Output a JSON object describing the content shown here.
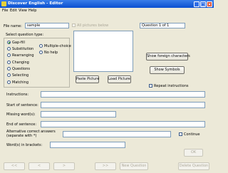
{
  "window": {
    "title": "Discover English - Editor",
    "minimize": "_",
    "maximize": "□",
    "close": "×"
  },
  "menu": [
    "File",
    "Edit",
    "View",
    "Help"
  ],
  "file": {
    "label": "File name:",
    "value": "sample",
    "all_pictures_label": "All pictures below"
  },
  "question_counter": "Question 1 of 1",
  "question_type": {
    "label": "Select question type:",
    "left": [
      {
        "label": "Gap-fill",
        "selected": true
      },
      {
        "label": "Substitution",
        "selected": false
      },
      {
        "label": "Rearranging",
        "selected": false
      },
      {
        "label": "Changing",
        "selected": false
      },
      {
        "label": "Questions",
        "selected": false
      },
      {
        "label": "Selecting",
        "selected": false
      },
      {
        "label": "Matching",
        "selected": false
      }
    ],
    "right": [
      {
        "label": "Multiple-choice",
        "selected": false
      },
      {
        "label": "No help",
        "selected": false
      }
    ]
  },
  "buttons": {
    "paste_picture": "Paste Picture",
    "load_picture": "Load Picture",
    "show_foreign": "Show foreign characters",
    "show_symbols": "Show Symbols",
    "ok": "OK"
  },
  "repeat_instructions": "Repeat instructions",
  "continue": "Continue",
  "form": {
    "instructions": "Instructions:",
    "start": "Start of sentence:",
    "missing": "Missing word(s):",
    "end": "End of sentence:",
    "alt_line1": "Alternative correct answers",
    "alt_line2": "(separate with *)",
    "brackets": "Word(s) in brackets:"
  },
  "nav": {
    "first": "<<",
    "prev": "<",
    "next": ">",
    "last": ">>",
    "new_question": "New Question",
    "delete_question": "Delete Question"
  }
}
